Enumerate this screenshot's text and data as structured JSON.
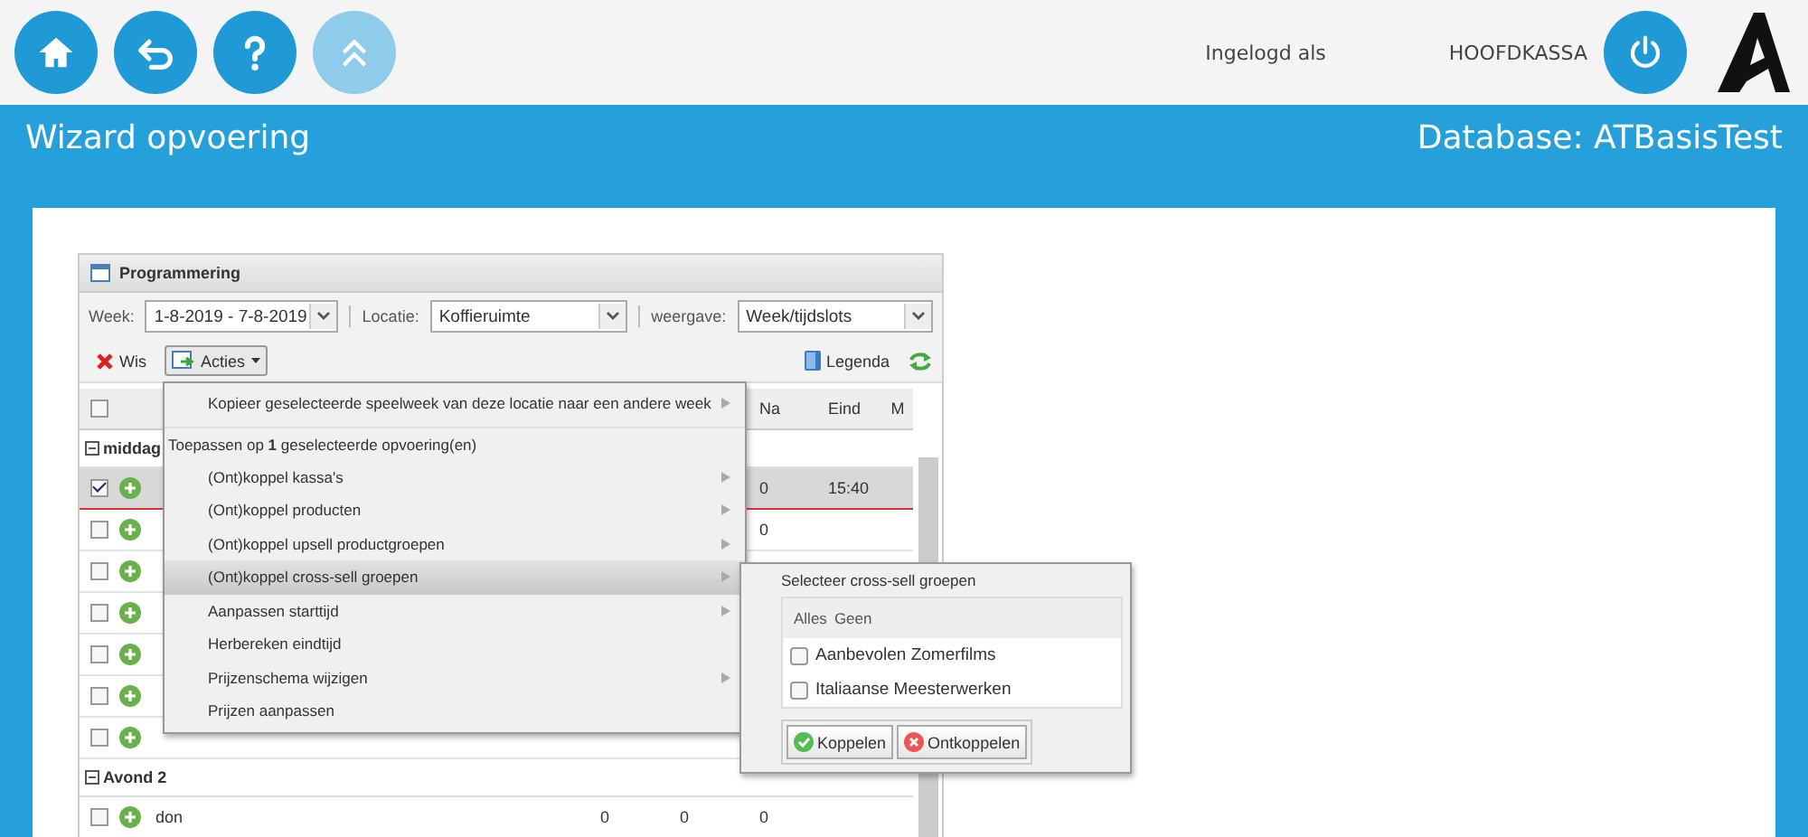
{
  "top_bar": {
    "buttons": [
      {
        "kind": "home",
        "disabled": false
      },
      {
        "kind": "back",
        "disabled": false
      },
      {
        "kind": "help",
        "disabled": false
      },
      {
        "kind": "collapse",
        "disabled": true
      }
    ],
    "logged_in_label": "Ingelogd als",
    "user": "HOOFDKASSA"
  },
  "title_bar": {
    "title": "Wizard opvoering",
    "database": "Database: ATBasisTest"
  },
  "panel": {
    "title": "Programmering",
    "filters": [
      {
        "label": "Week:",
        "value": "1-8-2019 - 7-8-2019"
      },
      {
        "label": "Locatie:",
        "value": "Koffieruimte"
      },
      {
        "label": "weergave:",
        "value": "Week/tijdslots"
      }
    ],
    "toolbar": {
      "delete": "Wis",
      "actions": "Acties",
      "legend": "Legenda"
    },
    "select_all_checked": false,
    "columns": [
      "Na",
      "Eind",
      "M"
    ],
    "groups": [
      {
        "name": "middag",
        "rows": [
          {
            "selected": true,
            "cells": [
              "",
              "",
              "0",
              "15:40"
            ]
          },
          {
            "selected": false,
            "cells": [
              "",
              "",
              "0",
              ""
            ]
          },
          {
            "selected": false,
            "cells": [
              "",
              "",
              "",
              ""
            ]
          },
          {
            "selected": false,
            "cells": [
              "",
              "",
              "",
              ""
            ]
          },
          {
            "selected": false,
            "cells": [
              "",
              "",
              "",
              ""
            ]
          },
          {
            "selected": false,
            "cells": [
              "",
              "",
              "",
              ""
            ]
          },
          {
            "selected": false,
            "cells": [
              "",
              "",
              "",
              ""
            ]
          }
        ]
      },
      {
        "name": "Avond 2",
        "rows": [
          {
            "selected": false,
            "name": "don",
            "cells": [
              "0",
              "0",
              "0",
              ""
            ]
          }
        ]
      }
    ]
  },
  "actions_menu": {
    "items": [
      {
        "kind": "item",
        "label": "Kopieer geselecteerde speelweek van deze locatie naar een andere week",
        "submenu": true,
        "selected": false
      },
      {
        "kind": "heading",
        "label": "Toepassen op **1** geselecteerde opvoering(en)"
      },
      {
        "kind": "item",
        "label": "(Ont)koppel kassa's",
        "submenu": true,
        "selected": false
      },
      {
        "kind": "item",
        "label": "(Ont)koppel producten",
        "submenu": true,
        "selected": false
      },
      {
        "kind": "item",
        "label": "(Ont)koppel upsell productgroepen",
        "submenu": true,
        "selected": false
      },
      {
        "kind": "item",
        "label": "(Ont)koppel cross-sell groepen",
        "submenu": true,
        "selected": true
      },
      {
        "kind": "item",
        "label": "Aanpassen starttijd",
        "submenu": true,
        "selected": false
      },
      {
        "kind": "item",
        "label": "Herbereken eindtijd",
        "submenu": false,
        "selected": false
      },
      {
        "kind": "item",
        "label": "Prijzenschema wijzigen",
        "submenu": true,
        "selected": false
      },
      {
        "kind": "item",
        "label": "Prijzen aanpassen",
        "submenu": false,
        "selected": false
      }
    ]
  },
  "cross_sell_menu": {
    "title": "Selecteer cross-sell groepen",
    "select_all": "Alles",
    "select_none": "Geen",
    "options": [
      {
        "label": "Aanbevolen Zomerfilms",
        "checked": false
      },
      {
        "label": "Italiaanse Meesterwerken",
        "checked": false
      }
    ],
    "buttons": [
      {
        "kind": "ok",
        "label": "Koppelen"
      },
      {
        "kind": "cancel",
        "label": "Ontkoppelen"
      }
    ]
  }
}
